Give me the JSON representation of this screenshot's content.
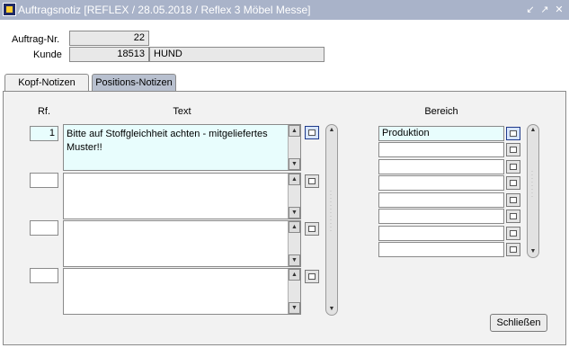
{
  "window": {
    "title": "Auftragsnotiz  [REFLEX / 28.05.2018 / Reflex 3 Möbel Messe]",
    "icons": [
      "minimize-arrow-icon",
      "maximize-icon",
      "close-icon"
    ]
  },
  "header": {
    "auftrag_label": "Auftrag-Nr.",
    "auftrag_value": "22",
    "kunde_label": "Kunde",
    "kunde_number": "18513",
    "kunde_name": "HUND"
  },
  "tabs": [
    {
      "label": "Kopf-Notizen",
      "active": true
    },
    {
      "label": "Positions-Notizen",
      "active": false
    }
  ],
  "columns": {
    "rf": "Rf.",
    "text": "Text",
    "bereich": "Bereich"
  },
  "notes": [
    {
      "rf": "1",
      "text": "Bitte auf Stoffgleichheit achten - mitgeliefertes Muster!!"
    },
    {
      "rf": "",
      "text": ""
    },
    {
      "rf": "",
      "text": ""
    },
    {
      "rf": "",
      "text": ""
    }
  ],
  "bereich": [
    "Produktion",
    "",
    "",
    "",
    "",
    "",
    "",
    ""
  ],
  "buttons": {
    "close": "Schließen"
  },
  "colors": {
    "titlebar": "#a9b3c9",
    "active_field": "#e8fdfd",
    "inactive_tab": "#b8c0cf"
  }
}
